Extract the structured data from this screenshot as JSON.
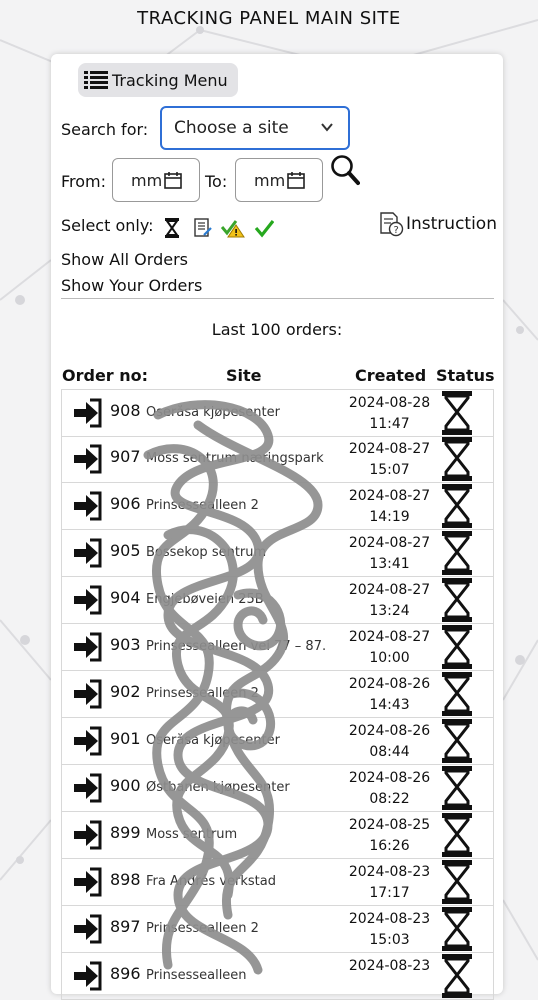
{
  "page": {
    "title": "TRACKING PANEL MAIN SITE"
  },
  "menu": {
    "label": "Tracking Menu"
  },
  "search": {
    "label": "Search for:",
    "select_value": "Choose a site"
  },
  "dates": {
    "from_label": "From:",
    "to_label": "To:",
    "from_value": "mm",
    "to_value": "mm"
  },
  "filters": {
    "label": "Select only:",
    "icons": [
      "hourglass-icon",
      "notepad-icon",
      "check-warning-icon",
      "green-check-icon"
    ]
  },
  "instruction": {
    "label": "Instruction"
  },
  "links": {
    "show_all": "Show All Orders",
    "show_yours": "Show Your Orders"
  },
  "table": {
    "caption": "Last 100 orders:",
    "headers": [
      "Order no:",
      "Site",
      "Created",
      "Status"
    ],
    "rows": [
      {
        "order": "908",
        "site": "Oseråsa kjøpesenter",
        "date": "2024-08-28",
        "time": "11:47",
        "status": "hourglass-icon"
      },
      {
        "order": "907",
        "site": "Moss sentrum næringspark",
        "date": "2024-08-27",
        "time": "15:07",
        "status": "hourglass-icon"
      },
      {
        "order": "906",
        "site": "Prinsessealleen 2",
        "date": "2024-08-27",
        "time": "14:19",
        "status": "hourglass-icon"
      },
      {
        "order": "905",
        "site": "Bossekop sentrum",
        "date": "2024-08-27",
        "time": "13:41",
        "status": "hourglass-icon"
      },
      {
        "order": "904",
        "site": "Engjebøveien 25B",
        "date": "2024-08-27",
        "time": "13:24",
        "status": "hourglass-icon"
      },
      {
        "order": "903",
        "site": "Prinsessealleen vei 77 – 87.",
        "date": "2024-08-27",
        "time": "10:00",
        "status": "hourglass-icon"
      },
      {
        "order": "902",
        "site": "Prinsessealleen 2",
        "date": "2024-08-26",
        "time": "14:43",
        "status": "hourglass-icon"
      },
      {
        "order": "901",
        "site": "Oseråsa kjøpesenter",
        "date": "2024-08-26",
        "time": "08:44",
        "status": "hourglass-icon"
      },
      {
        "order": "900",
        "site": "Østbanen kjøpesenter",
        "date": "2024-08-26",
        "time": "08:22",
        "status": "hourglass-icon"
      },
      {
        "order": "899",
        "site": "Moss sentrum",
        "date": "2024-08-25",
        "time": "16:26",
        "status": "hourglass-icon"
      },
      {
        "order": "898",
        "site": "Fra Andrés verkstad",
        "date": "2024-08-23",
        "time": "17:17",
        "status": "hourglass-icon"
      },
      {
        "order": "897",
        "site": "Prinsessealleen 2",
        "date": "2024-08-23",
        "time": "15:03",
        "status": "hourglass-icon"
      },
      {
        "order": "896",
        "site": "Prinsessealleen",
        "date": "2024-08-23",
        "time": "",
        "status": "hourglass-icon"
      }
    ]
  }
}
